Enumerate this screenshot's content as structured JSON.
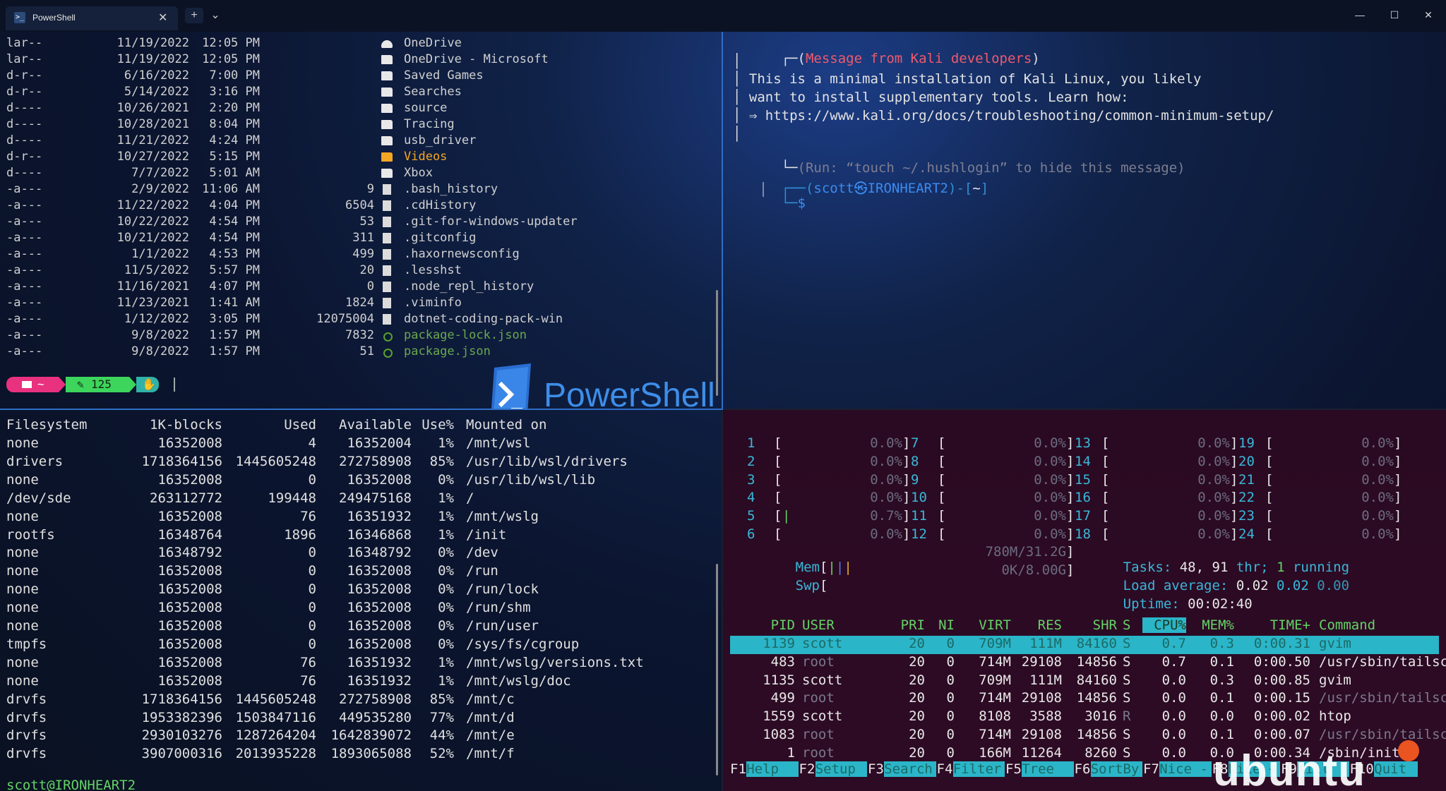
{
  "window": {
    "tab_title": "PowerShell",
    "tab_icon": "powershell-icon",
    "new_tab": "+",
    "dropdown": "⌄",
    "close_tab": "✕",
    "minimize": "—",
    "maximize": "☐",
    "close": "✕"
  },
  "listing": {
    "rows": [
      {
        "mode": "lar--",
        "date": "11/19/2022",
        "time": "12:05 PM",
        "size": "",
        "icon": "cloud",
        "name": "OneDrive"
      },
      {
        "mode": "lar--",
        "date": "11/19/2022",
        "time": "12:05 PM",
        "size": "",
        "icon": "folder",
        "name": "OneDrive - Microsoft"
      },
      {
        "mode": "d-r--",
        "date": "6/16/2022",
        "time": "7:00 PM",
        "size": "",
        "icon": "folder",
        "name": "Saved Games"
      },
      {
        "mode": "d-r--",
        "date": "5/14/2022",
        "time": "3:16 PM",
        "size": "",
        "icon": "folder",
        "name": "Searches"
      },
      {
        "mode": "d----",
        "date": "10/26/2021",
        "time": "2:20 PM",
        "size": "",
        "icon": "folder",
        "name": "source"
      },
      {
        "mode": "d----",
        "date": "10/28/2021",
        "time": "8:04 PM",
        "size": "",
        "icon": "folder",
        "name": "Tracing"
      },
      {
        "mode": "d----",
        "date": "11/21/2022",
        "time": "4:24 PM",
        "size": "",
        "icon": "folder",
        "name": "usb_driver"
      },
      {
        "mode": "d-r--",
        "date": "10/27/2022",
        "time": "5:15 PM",
        "size": "",
        "icon": "videos",
        "name": "Videos"
      },
      {
        "mode": "d----",
        "date": "7/7/2022",
        "time": "5:01 AM",
        "size": "",
        "icon": "folder",
        "name": "Xbox"
      },
      {
        "mode": "-a---",
        "date": "2/9/2022",
        "time": "11:06 AM",
        "size": "9",
        "icon": "file",
        "name": ".bash_history"
      },
      {
        "mode": "-a---",
        "date": "11/22/2022",
        "time": "4:04 PM",
        "size": "6504",
        "icon": "file",
        "name": ".cdHistory"
      },
      {
        "mode": "-a---",
        "date": "10/22/2022",
        "time": "4:54 PM",
        "size": "53",
        "icon": "file",
        "name": ".git-for-windows-updater"
      },
      {
        "mode": "-a---",
        "date": "10/21/2022",
        "time": "4:54 PM",
        "size": "311",
        "icon": "file",
        "name": ".gitconfig"
      },
      {
        "mode": "-a---",
        "date": "1/1/2022",
        "time": "4:53 PM",
        "size": "499",
        "icon": "file",
        "name": ".haxornewsconfig"
      },
      {
        "mode": "-a---",
        "date": "11/5/2022",
        "time": "5:57 PM",
        "size": "20",
        "icon": "file",
        "name": ".lesshst"
      },
      {
        "mode": "-a---",
        "date": "11/16/2021",
        "time": "4:07 PM",
        "size": "0",
        "icon": "file",
        "name": ".node_repl_history"
      },
      {
        "mode": "-a---",
        "date": "11/23/2021",
        "time": "1:41 AM",
        "size": "1824",
        "icon": "file",
        "name": ".viminfo"
      },
      {
        "mode": "-a---",
        "date": "1/12/2022",
        "time": "3:05 PM",
        "size": "12075004",
        "icon": "file",
        "name": "dotnet-coding-pack-win"
      },
      {
        "mode": "-a---",
        "date": "9/8/2022",
        "time": "1:57 PM",
        "size": "7832",
        "icon": "npm",
        "name": "package-lock.json"
      },
      {
        "mode": "-a---",
        "date": "9/8/2022",
        "time": "1:57 PM",
        "size": "51",
        "icon": "npm",
        "name": "package.json"
      }
    ],
    "prompt": {
      "home": "~",
      "count": "125",
      "folder_icon": "folder-icon",
      "pencil_icon": "pencil-icon",
      "hand_icon": "hand-icon"
    },
    "logo_text": "PowerShell"
  },
  "kali": {
    "line1": "┌─(Message from Kali developers)",
    "line2": "│",
    "line3": "│ This is a minimal installation of Kali Linux, you likely",
    "line4": "│ want to install supplementary tools. Learn how:",
    "line5": "│ ⇒ https://www.kali.org/docs/troubleshooting/common-minimum-setup/",
    "line6": "│",
    "line7a": "└─",
    "line7b": "(Run: “touch ~/.hushlogin” to hide this message)",
    "p_open": "┌──(",
    "p_user": "scott㉿IRONHEART2",
    "p_mid": ")-[",
    "p_dir": "~",
    "p_close": "]",
    "p2_prefix": "└─",
    "p2_dollar": "$"
  },
  "df": {
    "header": [
      "Filesystem",
      "1K-blocks",
      "Used",
      "Available",
      "Use%",
      "Mounted on"
    ],
    "rows": [
      [
        "none",
        "16352008",
        "4",
        "16352004",
        "1%",
        "/mnt/wsl"
      ],
      [
        "drivers",
        "1718364156",
        "1445605248",
        "272758908",
        "85%",
        "/usr/lib/wsl/drivers"
      ],
      [
        "none",
        "16352008",
        "0",
        "16352008",
        "0%",
        "/usr/lib/wsl/lib"
      ],
      [
        "/dev/sde",
        "263112772",
        "199448",
        "249475168",
        "1%",
        "/"
      ],
      [
        "none",
        "16352008",
        "76",
        "16351932",
        "1%",
        "/mnt/wslg"
      ],
      [
        "rootfs",
        "16348764",
        "1896",
        "16346868",
        "1%",
        "/init"
      ],
      [
        "none",
        "16348792",
        "0",
        "16348792",
        "0%",
        "/dev"
      ],
      [
        "none",
        "16352008",
        "0",
        "16352008",
        "0%",
        "/run"
      ],
      [
        "none",
        "16352008",
        "0",
        "16352008",
        "0%",
        "/run/lock"
      ],
      [
        "none",
        "16352008",
        "0",
        "16352008",
        "0%",
        "/run/shm"
      ],
      [
        "none",
        "16352008",
        "0",
        "16352008",
        "0%",
        "/run/user"
      ],
      [
        "tmpfs",
        "16352008",
        "0",
        "16352008",
        "0%",
        "/sys/fs/cgroup"
      ],
      [
        "none",
        "16352008",
        "76",
        "16351932",
        "1%",
        "/mnt/wslg/versions.txt"
      ],
      [
        "none",
        "16352008",
        "76",
        "16351932",
        "1%",
        "/mnt/wslg/doc"
      ],
      [
        "drvfs",
        "1718364156",
        "1445605248",
        "272758908",
        "85%",
        "/mnt/c"
      ],
      [
        "drvfs",
        "1953382396",
        "1503847116",
        "449535280",
        "77%",
        "/mnt/d"
      ],
      [
        "drvfs",
        "2930103276",
        "1287264204",
        "1642839072",
        "44%",
        "/mnt/e"
      ],
      [
        "drvfs",
        "3907000316",
        "2013935228",
        "1893065088",
        "52%",
        "/mnt/f"
      ]
    ],
    "prompt_user": "scott@IRONHEART2",
    "prompt_rest": ":~$"
  },
  "htop": {
    "cpus": [
      {
        "n": "1",
        "pct": "0.0%"
      },
      {
        "n": "2",
        "pct": "0.0%"
      },
      {
        "n": "3",
        "pct": "0.0%"
      },
      {
        "n": "4",
        "pct": "0.0%"
      },
      {
        "n": "5",
        "pct": "0.7%"
      },
      {
        "n": "6",
        "pct": "0.0%"
      },
      {
        "n": "7",
        "pct": "0.0%"
      },
      {
        "n": "8",
        "pct": "0.0%"
      },
      {
        "n": "9",
        "pct": "0.0%"
      },
      {
        "n": "10",
        "pct": "0.0%"
      },
      {
        "n": "11",
        "pct": "0.0%"
      },
      {
        "n": "12",
        "pct": "0.0%"
      },
      {
        "n": "13",
        "pct": "0.0%"
      },
      {
        "n": "14",
        "pct": "0.0%"
      },
      {
        "n": "15",
        "pct": "0.0%"
      },
      {
        "n": "16",
        "pct": "0.0%"
      },
      {
        "n": "17",
        "pct": "0.0%"
      },
      {
        "n": "18",
        "pct": "0.0%"
      },
      {
        "n": "19",
        "pct": "0.0%"
      },
      {
        "n": "20",
        "pct": "0.0%"
      },
      {
        "n": "21",
        "pct": "0.0%"
      },
      {
        "n": "22",
        "pct": "0.0%"
      },
      {
        "n": "23",
        "pct": "0.0%"
      },
      {
        "n": "24",
        "pct": "0.0%"
      }
    ],
    "mem_label": "Mem",
    "mem_value": "780M/31.2G",
    "swp_label": "Swp",
    "swp_value": "0K/8.00G",
    "tasks_label": "Tasks:",
    "tasks": "48,",
    "thr": "91",
    "thr_label": "thr;",
    "running": "1",
    "running_label": "running",
    "load_label": "Load average:",
    "load1": "0.02",
    "load5": "0.02",
    "load15": "0.00",
    "uptime_label": "Uptime:",
    "uptime": "00:02:40",
    "columns": [
      "PID",
      "USER",
      "PRI",
      "NI",
      "VIRT",
      "RES",
      "SHR",
      "S",
      "CPU%",
      "MEM%",
      "TIME+",
      "Command"
    ],
    "procs": [
      [
        "1139",
        "scott",
        "20",
        "0",
        "709M",
        "111M",
        "84160",
        "S",
        "0.7",
        "0.3",
        "0:00.31",
        "gvim"
      ],
      [
        "483",
        "root",
        "20",
        "0",
        "714M",
        "29108",
        "14856",
        "S",
        "0.7",
        "0.1",
        "0:00.50",
        "/usr/sbin/tailsc"
      ],
      [
        "1135",
        "scott",
        "20",
        "0",
        "709M",
        "111M",
        "84160",
        "S",
        "0.0",
        "0.3",
        "0:00.85",
        "gvim"
      ],
      [
        "499",
        "root",
        "20",
        "0",
        "714M",
        "29108",
        "14856",
        "S",
        "0.0",
        "0.1",
        "0:00.15",
        "/usr/sbin/tailsc"
      ],
      [
        "1559",
        "scott",
        "20",
        "0",
        "8108",
        "3588",
        "3016",
        "R",
        "0.0",
        "0.0",
        "0:00.02",
        "htop"
      ],
      [
        "1083",
        "root",
        "20",
        "0",
        "714M",
        "29108",
        "14856",
        "S",
        "0.0",
        "0.1",
        "0:00.07",
        "/usr/sbin/tailsc"
      ],
      [
        "1",
        "root",
        "20",
        "0",
        "166M",
        "11264",
        "8260",
        "S",
        "0.0",
        "0.0",
        "0:00.34",
        "/sbin/init"
      ]
    ],
    "fkeys": [
      {
        "k": "F1",
        "l": "Help"
      },
      {
        "k": "F2",
        "l": "Setup"
      },
      {
        "k": "F3",
        "l": "Search"
      },
      {
        "k": "F4",
        "l": "Filter"
      },
      {
        "k": "F5",
        "l": "Tree"
      },
      {
        "k": "F6",
        "l": "SortBy"
      },
      {
        "k": "F7",
        "l": "Nice -"
      },
      {
        "k": "F8",
        "l": "Nice +"
      },
      {
        "k": "F9",
        "l": "Kill"
      },
      {
        "k": "F10",
        "l": "Quit"
      }
    ],
    "watermark": "ubuntu"
  }
}
